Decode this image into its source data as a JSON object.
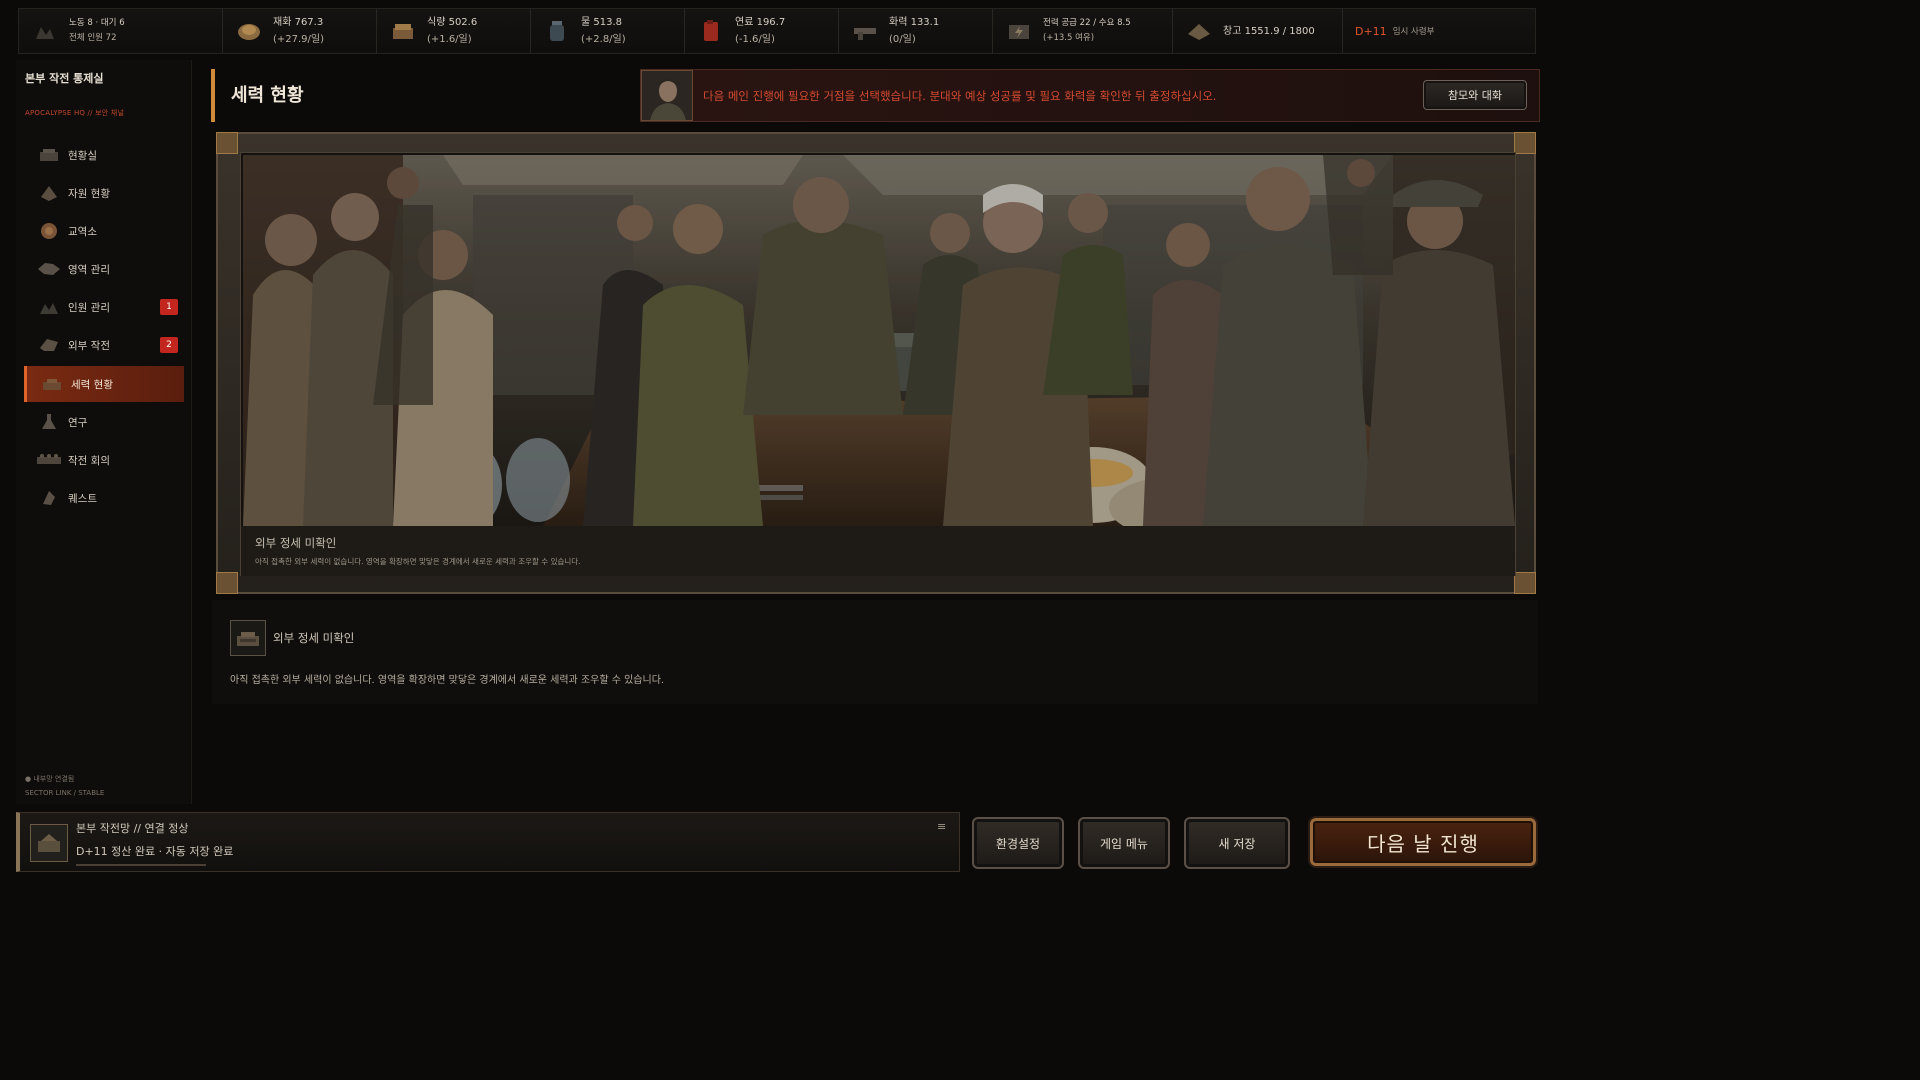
{
  "topbar": {
    "labor": {
      "line1": "노동 8 · 대기 6",
      "line2": "전체 인원 72"
    },
    "materials": {
      "line1": "재화 767.3",
      "line2": "(+27.9/일)"
    },
    "food": {
      "line1": "식량 502.6",
      "line2": "(+1.6/일)"
    },
    "water": {
      "line1": "물 513.8",
      "line2": "(+2.8/일)"
    },
    "fuel": {
      "line1": "연료 196.7",
      "line2": "(-1.6/일)"
    },
    "firepower": {
      "line1": "화력 133.1",
      "line2": "(0/일)"
    },
    "power": {
      "line1": "전력 공급 22 / 수요 8.5",
      "line2": "(+13.5 여유)"
    },
    "storage": {
      "line1": "창고  1551.9 / 1800"
    },
    "hq": {
      "day": "D+11",
      "role": "임시 사령부"
    }
  },
  "sidebar": {
    "title": "본부 작전 통제실",
    "subtitle": "APOCALYPSE HQ  //  보안 채널",
    "items": [
      {
        "label": "현황실",
        "icon": "status-room-icon"
      },
      {
        "label": "자원 현황",
        "icon": "resources-icon"
      },
      {
        "label": "교역소",
        "icon": "trade-icon"
      },
      {
        "label": "영역 관리",
        "icon": "territory-icon"
      },
      {
        "label": "인원 관리",
        "icon": "personnel-icon",
        "badge": "1"
      },
      {
        "label": "외부 작전",
        "icon": "external-ops-icon",
        "badge": "2"
      },
      {
        "label": "세력 현황",
        "icon": "factions-icon",
        "active": true
      },
      {
        "label": "연구",
        "icon": "research-icon"
      },
      {
        "label": "작전 회의",
        "icon": "briefing-icon"
      },
      {
        "label": "퀘스트",
        "icon": "quest-icon"
      }
    ],
    "status_line1": "● 내부망 연결됨",
    "status_line2": "SECTOR LINK / STABLE"
  },
  "header": {
    "title": "세력 현황"
  },
  "advisor": {
    "message": "다음 메인 진행에 필요한 거점을 선택했습니다. 분대와 예상 성공률 및 필요 화력을 확인한 뒤 출정하십시오.",
    "button": "참모와 대화"
  },
  "banner": {
    "caption_title": "외부 정세 미확인",
    "caption_desc": "아직 접촉한 외부 세력이 없습니다. 영역을 확장하면 맞닿은 경계에서 새로운 세력과 조우할 수 있습니다."
  },
  "info": {
    "title": "외부 정세 미확인",
    "desc": "아직 접촉한 외부 세력이 없습니다. 영역을 확장하면 맞닿은 경계에서 새로운 세력과 조우할 수 있습니다."
  },
  "bottombar": {
    "line1": "본부 작전망  //  연결 정상",
    "line2": "D+11 정산 완료 · 자동 저장 완료"
  },
  "buttons": {
    "settings": "환경설정",
    "game_menu": "게임 메뉴",
    "new_save": "새 저장",
    "next_day": "다음 날 진행"
  },
  "colors": {
    "accent": "#e0642a",
    "alert_text": "#d44a30",
    "badge": "#c2261f"
  }
}
